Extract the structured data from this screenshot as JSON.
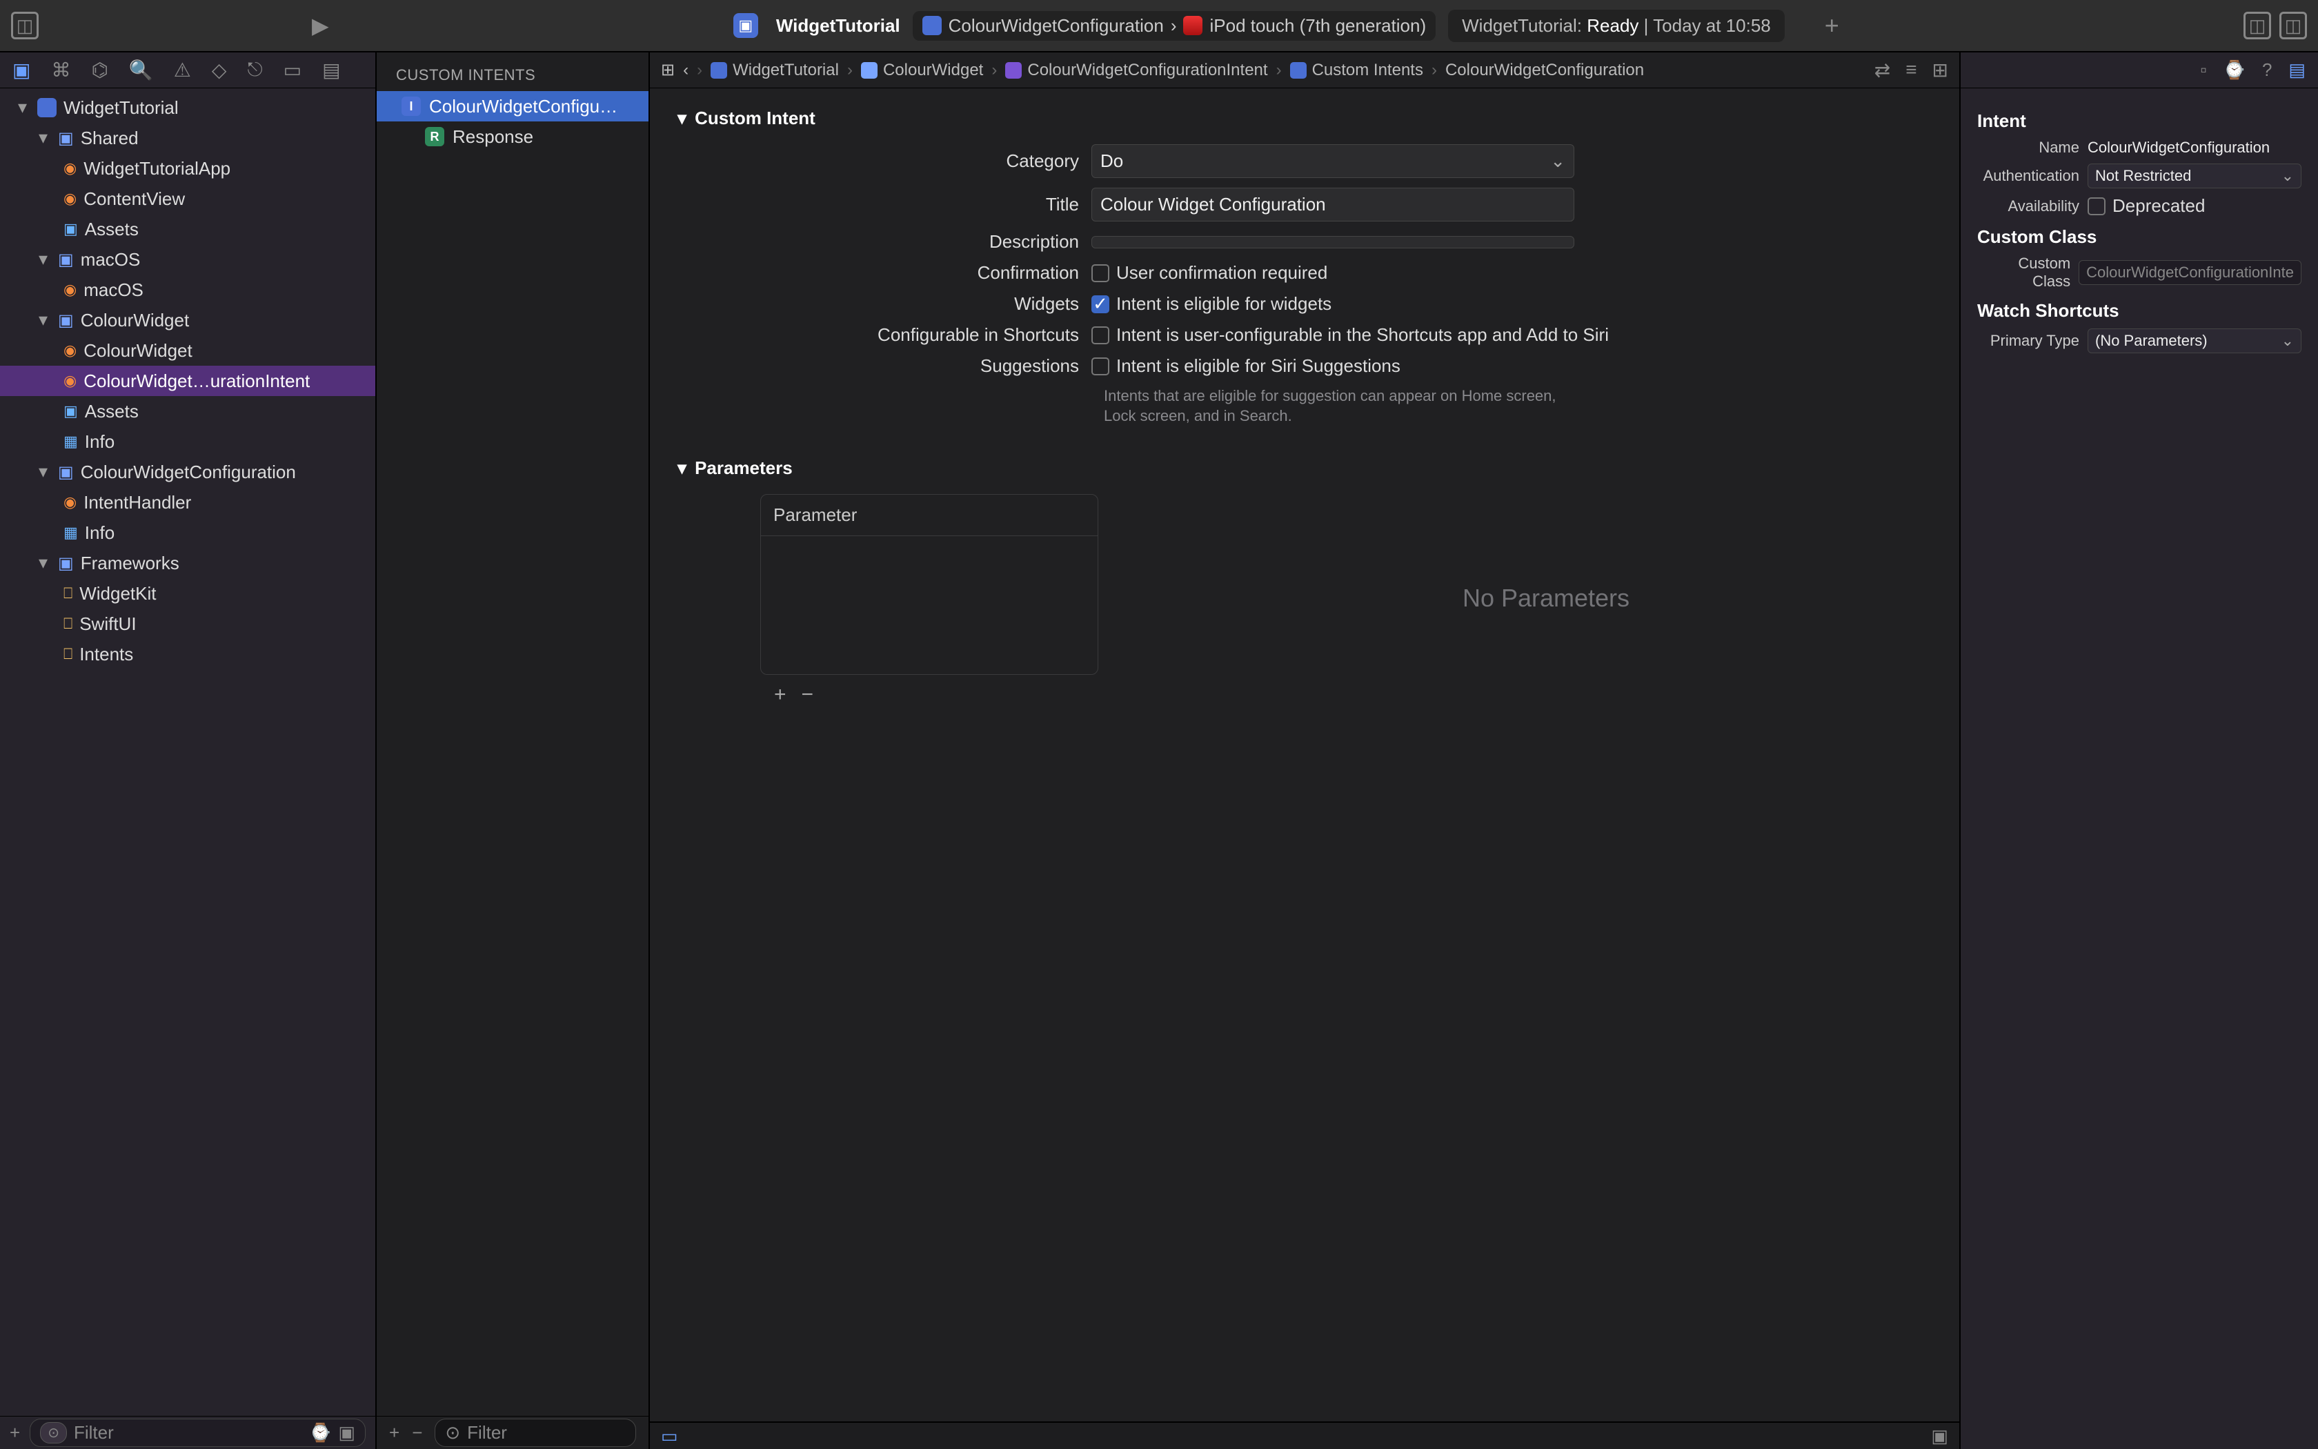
{
  "toolbar": {
    "project": "WidgetTutorial",
    "scheme": "ColourWidgetConfiguration",
    "device": "iPod touch (7th generation)",
    "status_prefix": "WidgetTutorial:",
    "status_state": "Ready",
    "status_sep": "|",
    "status_time": "Today at 10:58"
  },
  "navigator": {
    "filter_placeholder": "Filter",
    "tree": {
      "project": "WidgetTutorial",
      "shared": "Shared",
      "shared_items": [
        "WidgetTutorialApp",
        "ContentView",
        "Assets"
      ],
      "macos_group": "macOS",
      "macos_item": "macOS",
      "colourwidget_group": "ColourWidget",
      "colourwidget_items": [
        "ColourWidget",
        "ColourWidget…urationIntent",
        "Assets",
        "Info"
      ],
      "config_group": "ColourWidgetConfiguration",
      "config_items": [
        "IntentHandler",
        "Info"
      ],
      "frameworks_group": "Frameworks",
      "frameworks": [
        "WidgetKit",
        "SwiftUI",
        "Intents"
      ]
    }
  },
  "intents_panel": {
    "heading": "CUSTOM INTENTS",
    "items": [
      "ColourWidgetConfigu…",
      "Response"
    ],
    "filter_placeholder": "Filter"
  },
  "jump_bar": {
    "items": [
      "WidgetTutorial",
      "ColourWidget",
      "ColourWidgetConfigurationIntent",
      "Custom Intents",
      "ColourWidgetConfiguration"
    ]
  },
  "editor": {
    "section_custom_intent": "Custom Intent",
    "labels": {
      "category": "Category",
      "title": "Title",
      "description": "Description",
      "confirmation": "Confirmation",
      "widgets": "Widgets",
      "shortcuts": "Configurable in Shortcuts",
      "suggestions": "Suggestions"
    },
    "values": {
      "category": "Do",
      "title": "Colour Widget Configuration",
      "description": ""
    },
    "checkboxes": {
      "confirmation": "User confirmation required",
      "widgets": "Intent is eligible for widgets",
      "shortcuts": "Intent is user-configurable in the Shortcuts app and Add to Siri",
      "suggestions": "Intent is eligible for Siri Suggestions"
    },
    "suggestions_hint": "Intents that are eligible for suggestion can appear on Home screen, Lock screen, and in Search.",
    "parameters_heading": "Parameters",
    "parameter_col": "Parameter",
    "no_parameters": "No Parameters"
  },
  "inspector": {
    "heading_intent": "Intent",
    "name_label": "Name",
    "name_value": "ColourWidgetConfiguration",
    "auth_label": "Authentication",
    "auth_value": "Not Restricted",
    "avail_label": "Availability",
    "avail_cb": "Deprecated",
    "heading_class": "Custom Class",
    "class_label": "Custom Class",
    "class_placeholder": "ColourWidgetConfigurationInte",
    "heading_watch": "Watch Shortcuts",
    "primary_label": "Primary Type",
    "primary_value": "(No Parameters)"
  }
}
